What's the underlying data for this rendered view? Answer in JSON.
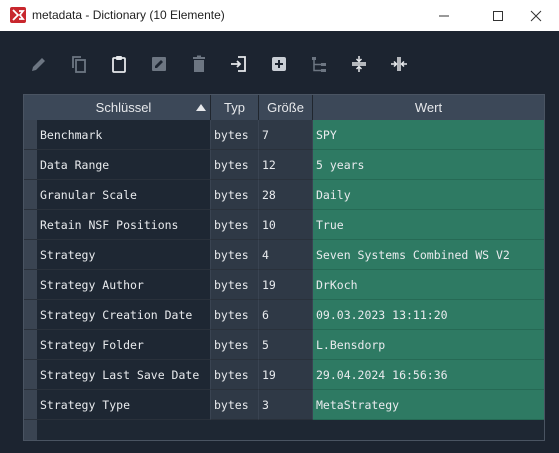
{
  "window": {
    "title": "metadata - Dictionary (10 Elemente)"
  },
  "toolbar": {
    "icons": [
      "pencil-icon",
      "copy-icon",
      "clipboard-icon",
      "image-edit-icon",
      "trash-icon",
      "import-icon",
      "add-icon",
      "tree-icon",
      "collapse-rows-icon",
      "collapse-cols-icon"
    ]
  },
  "table": {
    "columns": [
      "Schlüssel",
      "Typ",
      "Größe",
      "Wert"
    ],
    "sort_column": "Schlüssel",
    "rows": [
      {
        "key": "Benchmark",
        "type": "bytes",
        "size": "7",
        "value": "SPY"
      },
      {
        "key": "Data Range",
        "type": "bytes",
        "size": "12",
        "value": "5 years"
      },
      {
        "key": "Granular Scale",
        "type": "bytes",
        "size": "28",
        "value": "Daily"
      },
      {
        "key": "Retain NSF Positions",
        "type": "bytes",
        "size": "10",
        "value": "True"
      },
      {
        "key": "Strategy",
        "type": "bytes",
        "size": "4",
        "value": "Seven Systems Combined WS V2"
      },
      {
        "key": "Strategy Author",
        "type": "bytes",
        "size": "19",
        "value": "DrKoch"
      },
      {
        "key": "Strategy Creation Date",
        "type": "bytes",
        "size": "6",
        "value": "09.03.2023 13:11:20"
      },
      {
        "key": "Strategy Folder",
        "type": "bytes",
        "size": "5",
        "value": "L.Bensdorp"
      },
      {
        "key": "Strategy Last Save Date",
        "type": "bytes",
        "size": "19",
        "value": "29.04.2024 16:56:36"
      },
      {
        "key": "Strategy Type",
        "type": "bytes",
        "size": "3",
        "value": "MetaStrategy"
      }
    ]
  },
  "colors": {
    "value_bg": "#2e7a63",
    "key_bg": "#1e2733",
    "header_bg": "#3c4858",
    "window_bg": "#1c2430"
  }
}
